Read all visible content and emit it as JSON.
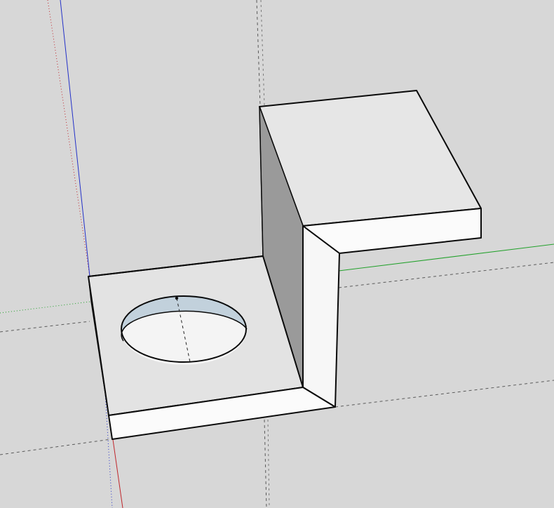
{
  "app": {
    "kind": "3D modeling viewport"
  },
  "scene": {
    "object": "z-bracket",
    "hole_count": 1
  },
  "colors": {
    "background": "#d7d7d7",
    "grid_line": "#5a5a5a",
    "edge": "#0a0a0a",
    "face_top": "#ececec",
    "face_front": "#fbfbfb",
    "face_vertical": "#f5f5f5",
    "face_shadow": "#9a9a9a",
    "hole_wall": "#c2d1dc",
    "hole_bottom": "#f4f4f4",
    "axis_red": "#c0262b",
    "axis_green": "#22a12b",
    "axis_blue": "#2330c8"
  },
  "icons": {
    "center_mark": "point-icon"
  }
}
